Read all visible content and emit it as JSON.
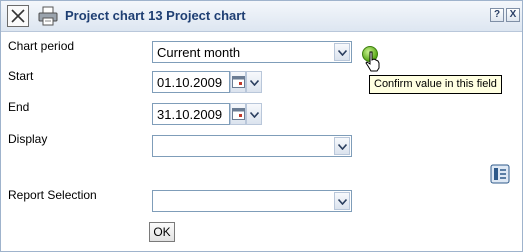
{
  "window": {
    "title": "Project chart 13 Project chart",
    "help_label": "?",
    "close_label": "X"
  },
  "form": {
    "chart_period": {
      "label": "Chart period",
      "value": "Current month"
    },
    "start": {
      "label": "Start",
      "value": "01.10.2009"
    },
    "end": {
      "label": "End",
      "value": "31.10.2009"
    },
    "display": {
      "label": "Display",
      "value": ""
    },
    "report_selection": {
      "label": "Report Selection",
      "value": ""
    },
    "ok_label": "OK"
  },
  "tooltip": {
    "text": "Confirm value in this field"
  },
  "icons": [
    "close-icon",
    "print-icon",
    "help-icon",
    "confirm-icon",
    "calendar-icon",
    "chevron-down-icon",
    "report-icon",
    "hand-cursor-icon"
  ]
}
